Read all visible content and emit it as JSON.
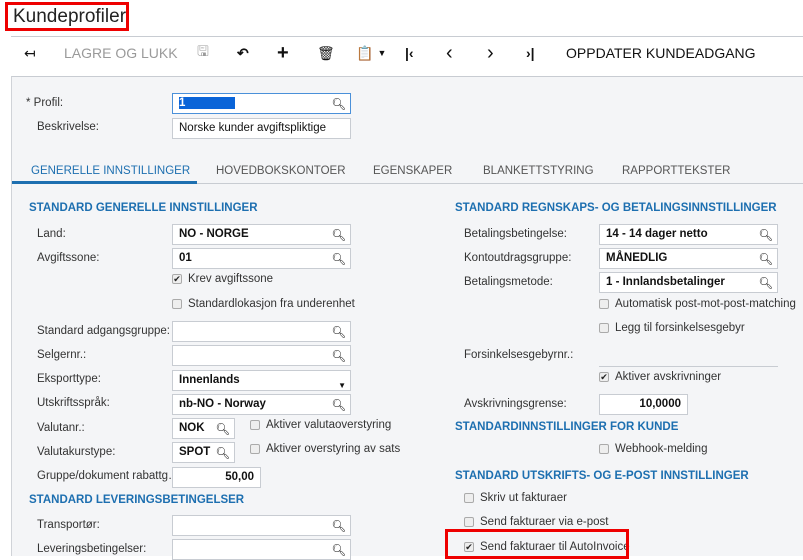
{
  "title": "Kundeprofiler",
  "toolbar": {
    "save_close": "LAGRE OG LUKK",
    "update_access": "OPPDATER KUNDEADGANG"
  },
  "header": {
    "profile_label": "Profil:",
    "profile_value": "1",
    "description_label": "Beskrivelse:",
    "description_value": "Norske kunder avgiftspliktige"
  },
  "tabs": [
    "GENERELLE INNSTILLINGER",
    "HOVEDBOKSKONTOER",
    "EGENSKAPER",
    "BLANKETTSTYRING",
    "RAPPORTTEKSTER"
  ],
  "left": {
    "section1": "STANDARD GENERELLE INNSTILLINGER",
    "land_label": "Land:",
    "land": "NO - NORGE",
    "tax_zone_label": "Avgiftssone:",
    "tax_zone": "01",
    "require_tax_zone": "Krev avgiftssone",
    "default_location": "Standardlokasjon fra underenhet",
    "access_group_label": "Standard adgangsgruppe:",
    "access_group": "",
    "salesperson_label": "Selgernr.:",
    "salesperson": "",
    "export_type_label": "Eksporttype:",
    "export_type": "Innenlands",
    "print_lang_label": "Utskriftsspråk:",
    "print_lang": "nb-NO - Norway",
    "currency_label": "Valutanr.:",
    "currency": "NOK",
    "currency_override": "Aktiver valutaoverstyring",
    "rate_type_label": "Valutakurstype:",
    "rate_type": "SPOT",
    "rate_override": "Aktiver overstyring av sats",
    "discount_label": "Gruppe/dokument rabattg…",
    "discount": "50,00",
    "section2": "STANDARD LEVERINGSBETINGELSER",
    "carrier_label": "Transportør:",
    "carrier": "",
    "delivery_terms_label": "Leveringsbetingelser:",
    "delivery_terms": ""
  },
  "right": {
    "section1": "STANDARD REGNSKAPS- OG BETALINGSINNSTILLINGER",
    "terms_label": "Betalingsbetingelse:",
    "terms": "14 - 14 dager netto",
    "statement_label": "Kontoutdragsgruppe:",
    "statement": "MÅNEDLIG",
    "payment_method_label": "Betalingsmetode:",
    "payment_method": "1 - Innlandsbetalinger",
    "auto_match": "Automatisk post-mot-post-matching",
    "late_fee": "Legg til forsinkelsesgebyr",
    "late_fee_no_label": "Forsinkelsesgebyrnr.:",
    "enable_writeoff": "Aktiver avskrivninger",
    "writeoff_limit_label": "Avskrivningsgrense:",
    "writeoff_limit": "10,0000",
    "section2": "STANDARDINNSTILLINGER FOR KUNDE",
    "webhook": "Webhook-melding",
    "section3": "STANDARD UTSKRIFTS- OG E-POST INNSTILLINGER",
    "print_invoices": "Skriv ut fakturaer",
    "email_invoices": "Send fakturaer via e-post",
    "autoinvoice": "Send fakturaer til AutoInvoice"
  },
  "checkbox_states": {
    "require_tax_zone": true,
    "default_location": false,
    "currency_override": false,
    "rate_override": false,
    "auto_match": false,
    "late_fee": false,
    "enable_writeoff": true,
    "webhook": false,
    "print_invoices": false,
    "email_invoices": false,
    "autoinvoice": true
  },
  "colors": {
    "accent": "#1d6fb0",
    "highlight": "#e00000",
    "selection": "#0a64d8"
  }
}
